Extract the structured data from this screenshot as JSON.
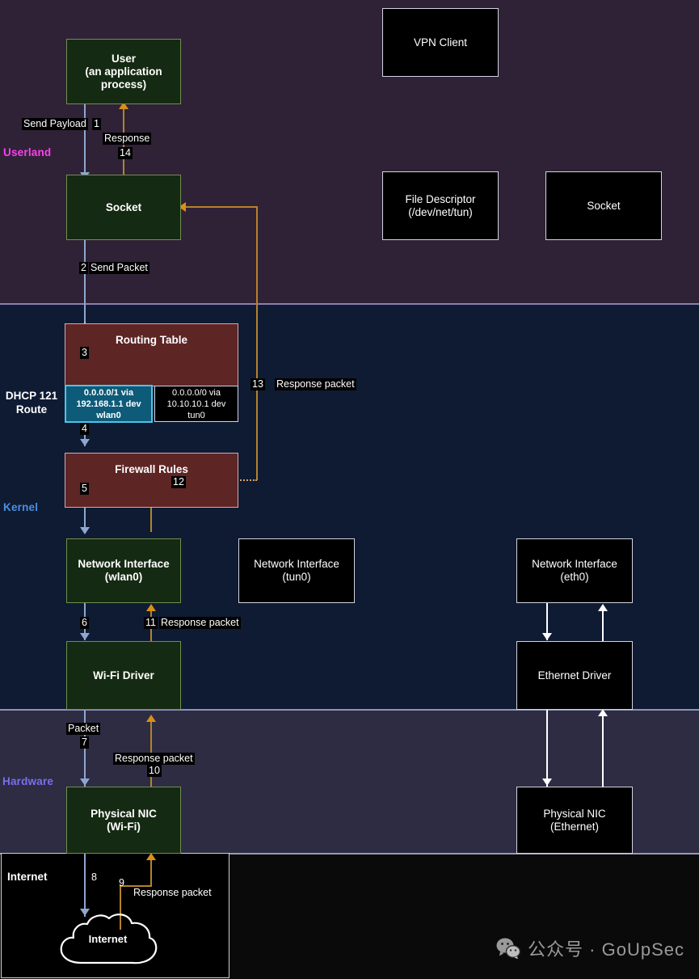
{
  "zones": [
    {
      "key": "userland",
      "label": "Userland",
      "color": "#ff3ff0"
    },
    {
      "key": "kernel",
      "label": "Kernel",
      "color": "#4a90e2"
    },
    {
      "key": "hardware",
      "label": "Hardware",
      "color": "#7b6ef0"
    },
    {
      "key": "internet",
      "label": "Internet",
      "color": "#ffffff"
    }
  ],
  "dhcp_route_label": "DHCP 121\nRoute",
  "dhcp_route_label_line1": "DHCP 121",
  "dhcp_route_label_line2": "Route",
  "nodes": {
    "user": {
      "line1": "User",
      "line2": "(an application",
      "line3": "process)",
      "style": "green"
    },
    "socket_user": {
      "label": "Socket",
      "style": "green"
    },
    "vpn_client": {
      "label": "VPN Client",
      "style": "black"
    },
    "file_descriptor": {
      "line1": "File Descriptor",
      "line2": "(/dev/net/tun)",
      "style": "black"
    },
    "socket_vpn": {
      "label": "Socket",
      "style": "black"
    },
    "routing_table": {
      "label": "Routing Table",
      "style": "red"
    },
    "route_wlan0": {
      "line1": "0.0.0.0/1 via",
      "line2": "192.168.1.1 dev",
      "line3": "wlan0",
      "style": "route-active"
    },
    "route_tun0": {
      "line1": "0.0.0.0/0 via",
      "line2": "10.10.10.1 dev",
      "line3": "tun0",
      "style": "route-idle"
    },
    "firewall_rules": {
      "label": "Firewall Rules",
      "style": "red"
    },
    "netif_wlan0": {
      "line1": "Network Interface",
      "line2": "(wlan0)",
      "style": "green"
    },
    "netif_tun0": {
      "line1": "Network Interface",
      "line2": "(tun0)",
      "style": "black"
    },
    "netif_eth0": {
      "line1": "Network Interface",
      "line2": "(eth0)",
      "style": "black"
    },
    "wifi_driver": {
      "label": "Wi-Fi Driver",
      "style": "green"
    },
    "ethernet_driver": {
      "label": "Ethernet Driver",
      "style": "black"
    },
    "nic_wifi": {
      "line1": "Physical NIC",
      "line2": "(Wi-Fi)",
      "style": "green"
    },
    "nic_ethernet": {
      "line1": "Physical NIC",
      "line2": "(Ethernet)",
      "style": "black"
    },
    "internet_cloud": {
      "label": "Internet",
      "style": "cloud"
    }
  },
  "edges": [
    {
      "num": "1",
      "text": "Send Payload",
      "from": "user",
      "to": "socket_user",
      "dir": "down"
    },
    {
      "num": "14",
      "text": "Response",
      "from": "socket_user",
      "to": "user",
      "dir": "up"
    },
    {
      "num": "2",
      "text": "Send Packet",
      "from": "socket_user",
      "to": "routing_table",
      "dir": "down"
    },
    {
      "num": "3",
      "text": "",
      "from": "routing_table",
      "to": "route_wlan0",
      "dir": "down"
    },
    {
      "num": "4",
      "text": "",
      "from": "route_wlan0",
      "to": "firewall_rules",
      "dir": "down"
    },
    {
      "num": "5",
      "text": "",
      "from": "firewall_rules",
      "to": "netif_wlan0",
      "dir": "down"
    },
    {
      "num": "6",
      "text": "",
      "from": "netif_wlan0",
      "to": "wifi_driver",
      "dir": "down"
    },
    {
      "num": "7",
      "text": "Packet",
      "from": "wifi_driver",
      "to": "nic_wifi",
      "dir": "down"
    },
    {
      "num": "8",
      "text": "",
      "from": "nic_wifi",
      "to": "internet_cloud",
      "dir": "down"
    },
    {
      "num": "9",
      "text": "Response packet",
      "from": "internet_cloud",
      "to": "nic_wifi",
      "dir": "up"
    },
    {
      "num": "10",
      "text": "Response packet",
      "from": "nic_wifi",
      "to": "wifi_driver",
      "dir": "up"
    },
    {
      "num": "11",
      "text": "Response packet",
      "from": "wifi_driver",
      "to": "netif_wlan0",
      "dir": "up"
    },
    {
      "num": "12",
      "text": "",
      "from": "netif_wlan0",
      "to": "firewall_rules",
      "dir": "up"
    },
    {
      "num": "13",
      "text": "Response packet",
      "from": "firewall_rules",
      "to": "socket_user",
      "dir": "up"
    }
  ],
  "edge_labels": {
    "send_payload": "Send Payload",
    "n1": "1",
    "response": "Response",
    "n14": "14",
    "n2": "2",
    "send_packet": "Send Packet",
    "n3": "3",
    "n4": "4",
    "n5": "5",
    "n6": "6",
    "n7": "7",
    "packet": "Packet",
    "n8": "8",
    "n9": "9",
    "n10": "10",
    "n11": "11",
    "n12": "12",
    "n13": "13",
    "response_packet_9": "Response packet",
    "response_packet_10": "Response packet",
    "response_packet_11": "Response packet",
    "response_packet_13": "Response packet"
  },
  "watermark": {
    "icon": "wechat-icon",
    "text": "公众号 · GoUpSec"
  },
  "colors": {
    "userland_bg": "#2f2237",
    "kernel_bg": "#0f1b33",
    "hardware_bg": "#2d2c42",
    "internet_bg": "#000000",
    "green_node": "#152a12",
    "green_border": "#6f8f4e",
    "red_node": "#5e2525",
    "red_border": "#d9a9b0",
    "route_active": "#0d5b78",
    "route_active_border": "#4ec3e8",
    "flow_blue": "#8fa6d0",
    "flow_orange": "#b5822a",
    "flow_white": "#ffffff"
  }
}
